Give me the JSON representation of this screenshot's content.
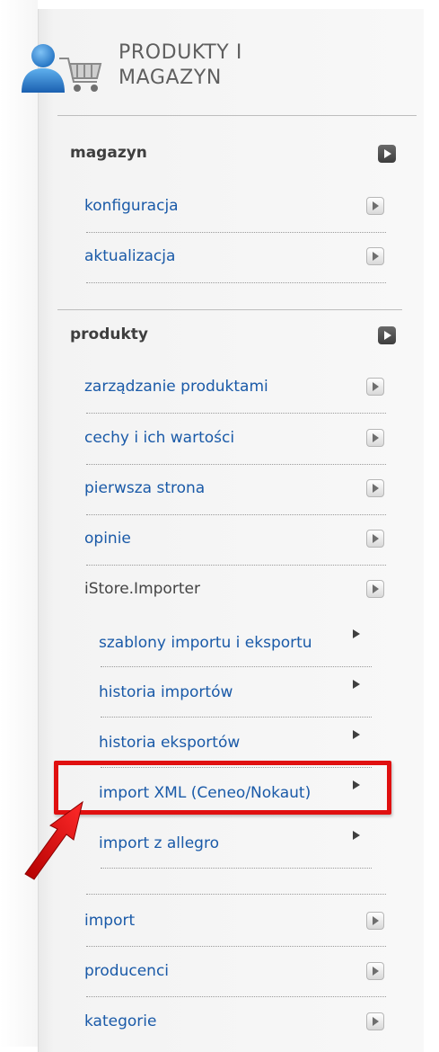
{
  "header": {
    "title": "PRODUKTY I\nMAGAZYN",
    "icon": "user-cart-icon"
  },
  "sections": [
    {
      "title": "magazyn",
      "items": [
        {
          "label": "konfiguracja"
        },
        {
          "label": "aktualizacja"
        }
      ]
    },
    {
      "title": "produkty",
      "items": [
        {
          "label": "zarządzanie produktami"
        },
        {
          "label": "cechy i ich wartości"
        },
        {
          "label": "pierwsza strona"
        },
        {
          "label": "opinie"
        },
        {
          "label": "iStore.Importer"
        }
      ],
      "subitems": [
        {
          "label": "szablony importu i eksportu"
        },
        {
          "label": "historia importów"
        },
        {
          "label": "historia eksportów"
        },
        {
          "label": "import XML (Ceneo/Nokaut)"
        },
        {
          "label": "import z allegro"
        }
      ],
      "items_after": [
        {
          "label": "import"
        },
        {
          "label": "producenci"
        },
        {
          "label": "kategorie"
        }
      ]
    }
  ],
  "colors": {
    "link": "#1a5aa8",
    "highlight": "#e01010"
  }
}
